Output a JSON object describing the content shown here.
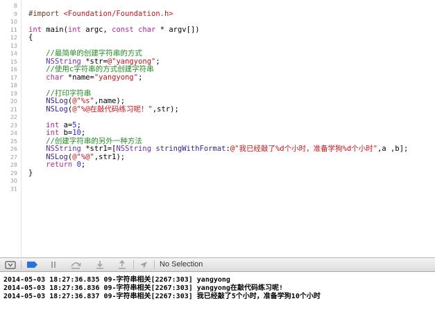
{
  "editor": {
    "line_numbers": [
      "8",
      "9",
      "10",
      "11",
      "12",
      "13",
      "14",
      "15",
      "16",
      "17",
      "18",
      "19",
      "20",
      "21",
      "22",
      "23",
      "24",
      "25",
      "26",
      "27",
      "28",
      "29",
      "30",
      "31"
    ],
    "lines": [
      [],
      [
        {
          "t": "#import ",
          "c": "pp"
        },
        {
          "t": "<Foundation/Foundation.h>",
          "c": "str"
        }
      ],
      [],
      [
        {
          "t": "int",
          "c": "kw"
        },
        {
          "t": " main("
        },
        {
          "t": "int",
          "c": "kw"
        },
        {
          "t": " argc, "
        },
        {
          "t": "const",
          "c": "kw"
        },
        {
          "t": " "
        },
        {
          "t": "char",
          "c": "kw"
        },
        {
          "t": " * argv[])"
        }
      ],
      [
        {
          "t": "{"
        }
      ],
      [],
      [
        {
          "t": "    //最简单的创建字符串的方式",
          "c": "cmt"
        }
      ],
      [
        {
          "t": "    "
        },
        {
          "t": "NSString",
          "c": "cls"
        },
        {
          "t": " *str="
        },
        {
          "t": "@\"yangyong\"",
          "c": "str"
        },
        {
          "t": ";"
        }
      ],
      [
        {
          "t": "    //使用c字符串的方式创建字符串",
          "c": "cmt"
        }
      ],
      [
        {
          "t": "    "
        },
        {
          "t": "char",
          "c": "kw"
        },
        {
          "t": " *name="
        },
        {
          "t": "\"yangyong\"",
          "c": "str"
        },
        {
          "t": ";"
        }
      ],
      [],
      [
        {
          "t": "    //打印字符串",
          "c": "cmt"
        }
      ],
      [
        {
          "t": "    "
        },
        {
          "t": "NSLog",
          "c": "fn"
        },
        {
          "t": "("
        },
        {
          "t": "@\"%s\"",
          "c": "str"
        },
        {
          "t": ",name);"
        }
      ],
      [
        {
          "t": "    "
        },
        {
          "t": "NSLog",
          "c": "fn"
        },
        {
          "t": "("
        },
        {
          "t": "@\"%@在敲代码练习呢！\"",
          "c": "str"
        },
        {
          "t": ",str);"
        }
      ],
      [],
      [
        {
          "t": "    "
        },
        {
          "t": "int",
          "c": "kw"
        },
        {
          "t": " a="
        },
        {
          "t": "5",
          "c": "num"
        },
        {
          "t": ";"
        }
      ],
      [
        {
          "t": "    "
        },
        {
          "t": "int",
          "c": "kw"
        },
        {
          "t": " b="
        },
        {
          "t": "10",
          "c": "num"
        },
        {
          "t": ";"
        }
      ],
      [
        {
          "t": "    //创建字符串的另外一种方法",
          "c": "cmt"
        }
      ],
      [
        {
          "t": "    "
        },
        {
          "t": "NSString",
          "c": "cls"
        },
        {
          "t": " *str1=["
        },
        {
          "t": "NSString",
          "c": "cls"
        },
        {
          "t": " "
        },
        {
          "t": "stringWithFormat",
          "c": "fn"
        },
        {
          "t": ":"
        },
        {
          "t": "@\"我已经敲了%d个小时，准备学狗%d个小时\"",
          "c": "str"
        },
        {
          "t": ",a ,b];"
        }
      ],
      [
        {
          "t": "    "
        },
        {
          "t": "NSLog",
          "c": "fn"
        },
        {
          "t": "("
        },
        {
          "t": "@\"%@\"",
          "c": "str"
        },
        {
          "t": ",str1);"
        }
      ],
      [
        {
          "t": "    "
        },
        {
          "t": "return",
          "c": "kw"
        },
        {
          "t": " "
        },
        {
          "t": "0",
          "c": "num"
        },
        {
          "t": ";"
        }
      ],
      [
        {
          "t": "}"
        }
      ],
      [],
      []
    ]
  },
  "debug_bar": {
    "buttons": [
      {
        "name": "hide-debug-area-icon",
        "x": 0
      },
      {
        "name": "breakpoints-toggle-icon",
        "x": 0
      },
      {
        "name": "pause-icon",
        "x": 0
      },
      {
        "name": "step-over-icon",
        "x": 0
      },
      {
        "name": "step-into-icon",
        "x": 0
      },
      {
        "name": "step-out-icon",
        "x": 0
      },
      {
        "name": "location-icon",
        "x": 0
      }
    ],
    "selection_label": "No Selection",
    "colors": {
      "breakpoint_active": "#2b72d8",
      "disabled_icon": "#a0a0a0"
    }
  },
  "console": {
    "lines": [
      "2014-05-03 18:27:36.835 09-字符串相关[2267:303] yangyong",
      "2014-05-03 18:27:36.836 09-字符串相关[2267:303] yangyong在敲代码练习呢!",
      "2014-05-03 18:27:36.837 09-字符串相关[2267:303] 我已经敲了5个小时，准备学狗10个小时"
    ]
  }
}
